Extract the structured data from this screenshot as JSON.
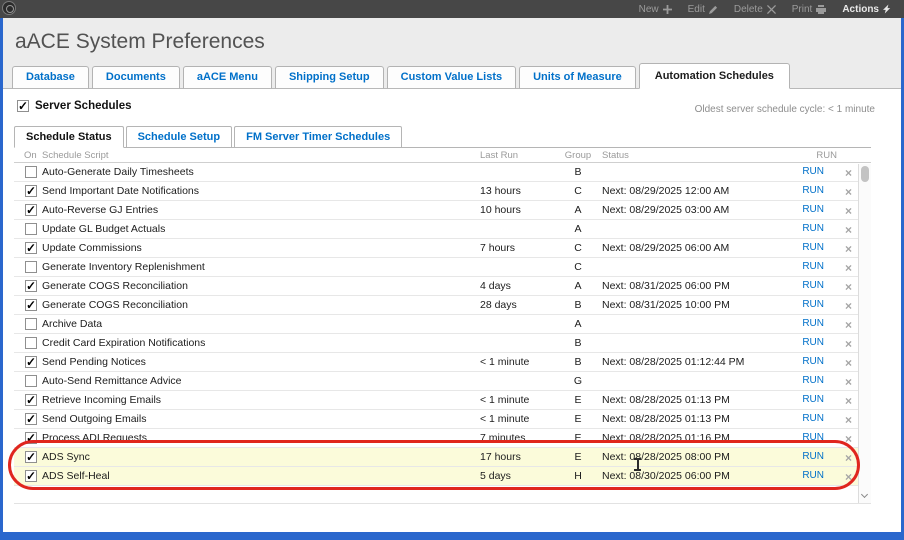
{
  "toolbar": {
    "buttons": [
      {
        "label": "New",
        "icon": "plus"
      },
      {
        "label": "Edit",
        "icon": "pencil"
      },
      {
        "label": "Delete",
        "icon": "x"
      },
      {
        "label": "Print",
        "icon": "printer"
      },
      {
        "label": "Actions",
        "icon": "lightning"
      }
    ]
  },
  "title": "aACE System Preferences",
  "tabs": {
    "labels": [
      "Database",
      "Documents",
      "aACE Menu",
      "Shipping Setup",
      "Custom Value Lists",
      "Units of Measure",
      "Automation Schedules"
    ],
    "active_index": 6
  },
  "server_schedules": {
    "label": "Server Schedules",
    "checked": true,
    "note": "Oldest server schedule cycle: < 1 minute"
  },
  "sub_tabs": {
    "labels": [
      "Schedule Status",
      "Schedule Setup",
      "FM Server Timer Schedules"
    ],
    "active_index": 0
  },
  "table": {
    "headers": {
      "on": "On",
      "script": "Schedule Script",
      "last_run": "Last Run",
      "group": "Group",
      "status": "Status",
      "run": "RUN"
    },
    "run_label": "RUN",
    "rows": [
      {
        "on": false,
        "script": "Auto-Generate Daily Timesheets",
        "last_run": "",
        "group": "B",
        "status": "",
        "highlight": false
      },
      {
        "on": true,
        "script": "Send Important Date Notifications",
        "last_run": "13 hours",
        "group": "C",
        "status": "Next: 08/29/2025 12:00 AM",
        "highlight": false
      },
      {
        "on": true,
        "script": "Auto-Reverse GJ Entries",
        "last_run": "10 hours",
        "group": "A",
        "status": "Next: 08/29/2025 03:00 AM",
        "highlight": false
      },
      {
        "on": false,
        "script": "Update GL Budget Actuals",
        "last_run": "",
        "group": "A",
        "status": "",
        "highlight": false
      },
      {
        "on": true,
        "script": "Update Commissions",
        "last_run": "7 hours",
        "group": "C",
        "status": "Next: 08/29/2025 06:00 AM",
        "highlight": false
      },
      {
        "on": false,
        "script": "Generate Inventory Replenishment",
        "last_run": "",
        "group": "C",
        "status": "",
        "highlight": false
      },
      {
        "on": true,
        "script": "Generate COGS Reconciliation",
        "last_run": "4 days",
        "group": "A",
        "status": "Next: 08/31/2025 06:00 PM",
        "highlight": false
      },
      {
        "on": true,
        "script": "Generate COGS Reconciliation",
        "last_run": "28 days",
        "group": "B",
        "status": "Next: 08/31/2025 10:00 PM",
        "highlight": false
      },
      {
        "on": false,
        "script": "Archive Data",
        "last_run": "",
        "group": "A",
        "status": "",
        "highlight": false
      },
      {
        "on": false,
        "script": "Credit Card Expiration Notifications",
        "last_run": "",
        "group": "B",
        "status": "",
        "highlight": false
      },
      {
        "on": true,
        "script": "Send Pending Notices",
        "last_run": "< 1 minute",
        "group": "B",
        "status": "Next: 08/28/2025 01:12:44 PM",
        "highlight": false
      },
      {
        "on": false,
        "script": "Auto-Send Remittance Advice",
        "last_run": "",
        "group": "G",
        "status": "",
        "highlight": false
      },
      {
        "on": true,
        "script": "Retrieve Incoming Emails",
        "last_run": "< 1 minute",
        "group": "E",
        "status": "Next: 08/28/2025 01:13 PM",
        "highlight": false
      },
      {
        "on": true,
        "script": "Send Outgoing Emails",
        "last_run": "< 1 minute",
        "group": "E",
        "status": "Next: 08/28/2025 01:13 PM",
        "highlight": false
      },
      {
        "on": true,
        "script": "Process ADI Requests",
        "last_run": "7 minutes",
        "group": "E",
        "status": "Next: 08/28/2025 01:16 PM",
        "highlight": false
      },
      {
        "on": true,
        "script": "ADS Sync",
        "last_run": "17 hours",
        "group": "E",
        "status": "Next: 08/28/2025 08:00 PM",
        "highlight": true
      },
      {
        "on": true,
        "script": "ADS Self-Heal",
        "last_run": "5 days",
        "group": "H",
        "status": "Next: 08/30/2025 06:00 PM",
        "highlight": true
      }
    ]
  },
  "colors": {
    "accent_blue": "#0070c9",
    "highlight_yellow": "#fbfbda",
    "annotation_red": "#e0261e",
    "toolbar_bg": "#474747",
    "header_bg": "#ececec",
    "frame_blue": "#2a67cd"
  }
}
